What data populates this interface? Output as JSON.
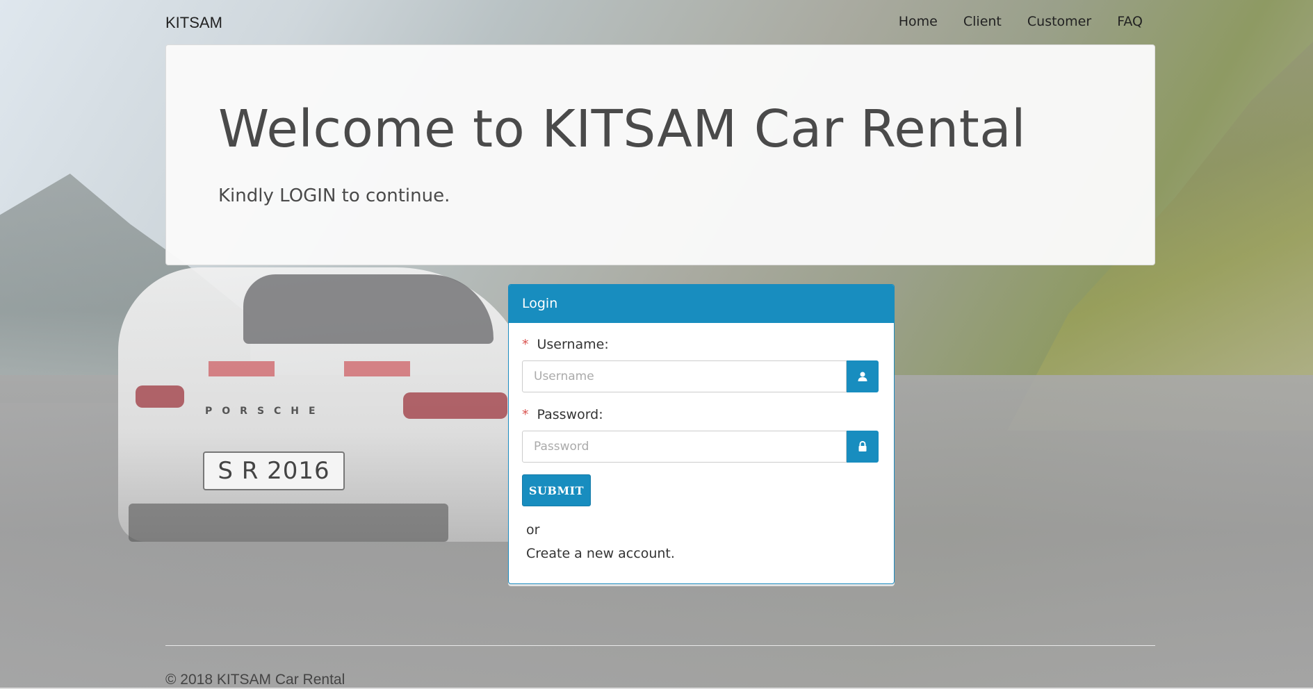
{
  "navbar": {
    "brand": "KITSAM",
    "links": [
      "Home",
      "Client",
      "Customer",
      "FAQ"
    ]
  },
  "jumbotron": {
    "title": "Welcome to KITSAM Car Rental",
    "subtitle": "Kindly LOGIN to continue."
  },
  "background": {
    "plate_text": "S R 2016",
    "brand_text": "PORSCHE"
  },
  "login": {
    "heading": "Login",
    "username_label": "Username:",
    "username_placeholder": "Username",
    "username_value": "",
    "password_label": "Password:",
    "password_placeholder": "Password",
    "password_value": "",
    "required_marker": "*",
    "submit_label": "SUBMIT",
    "or_text": "or",
    "create_account_text": "Create a new account.",
    "user_icon": "user-icon",
    "lock_icon": "lock-icon"
  },
  "footer": {
    "copyright": "© 2018 KITSAM Car Rental"
  },
  "colors": {
    "primary": "#188dbf",
    "required": "#d9534f"
  }
}
